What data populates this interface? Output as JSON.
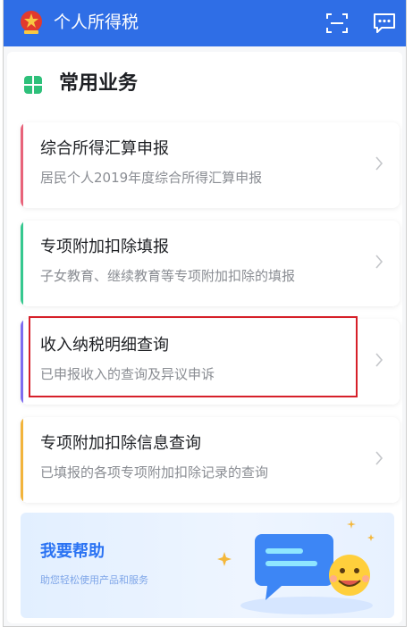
{
  "header": {
    "title": "个人所得税",
    "logo_icon": "tax-emblem-icon",
    "scan_icon": "scan-icon",
    "message_icon": "message-icon",
    "bg_color": "#2f6ee6"
  },
  "section": {
    "title": "常用业务",
    "icon": "four-leaf-grid-icon",
    "icon_color": "#2ec07a"
  },
  "cards": [
    {
      "title": "综合所得汇算申报",
      "subtitle": "居民个人2019年度综合所得汇算申报",
      "accent": "#e8637a"
    },
    {
      "title": "专项附加扣除填报",
      "subtitle": "子女教育、继续教育等专项附加扣除的填报",
      "accent": "#36c88f"
    },
    {
      "title": "收入纳税明细查询",
      "subtitle": "已申报收入的查询及异议申诉",
      "accent": "#7e6cf0",
      "highlighted": true
    },
    {
      "title": "专项附加扣除信息查询",
      "subtitle": "已填报的各项专项附加扣除记录的查询",
      "accent": "#f2b43c"
    }
  ],
  "help": {
    "title": "我要帮助",
    "subtitle": "助您轻松使用产品和服务",
    "illustration_icon": "chat-bubble-smiley-icon"
  },
  "highlight_color": "#d6202a"
}
